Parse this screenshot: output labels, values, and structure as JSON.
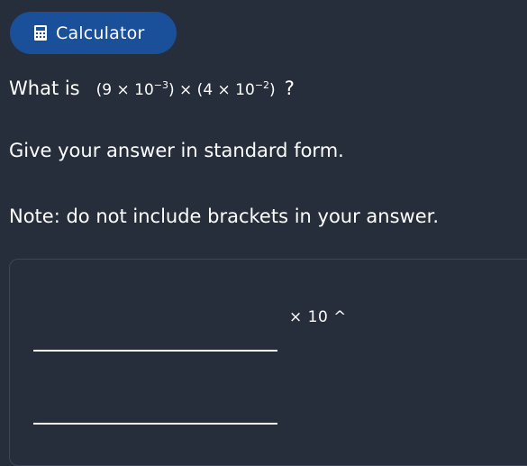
{
  "calculator_button": {
    "label": "Calculator",
    "icon": "calculator-icon",
    "color": "#1a4f9a"
  },
  "question": {
    "prefix": "What is",
    "expression": {
      "open1": "(9 × 10",
      "exp1": "−3",
      "middle": ") × (4 × 10",
      "exp2": "−2",
      "close": ")"
    },
    "suffix": "?"
  },
  "instruction": "Give your answer in standard form.",
  "note": "Note: do not include brackets in your answer.",
  "answer": {
    "coefficient_value": "",
    "multiplier_label": "× 10 ^",
    "exponent_value": ""
  },
  "colors": {
    "background": "#262d3b",
    "text": "#ffffff",
    "panel_border": "#3e4658"
  }
}
